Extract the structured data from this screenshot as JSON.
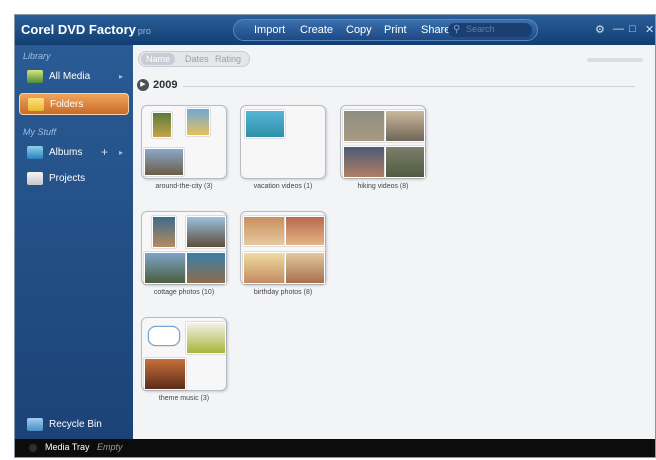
{
  "app": {
    "title": "Corel DVD Factory",
    "title_suffix": "pro"
  },
  "menu": [
    {
      "label": "Import"
    },
    {
      "label": "Create"
    },
    {
      "label": "Copy"
    },
    {
      "label": "Print"
    },
    {
      "label": "Share"
    }
  ],
  "search": {
    "placeholder": "Search"
  },
  "sidebar": {
    "library_heading": "Library",
    "mystuff_heading": "My Stuff",
    "items": [
      {
        "label": "All Media"
      },
      {
        "label": "Folders",
        "selected": true
      },
      {
        "label": "Albums"
      },
      {
        "label": "Projects"
      }
    ],
    "recycle_bin": "Recycle Bin"
  },
  "sort_tabs": [
    {
      "label": "Name",
      "active": true
    },
    {
      "label": "Dates"
    },
    {
      "label": "Rating"
    }
  ],
  "year_group": "2009",
  "folders": [
    {
      "name": "around-the-city (3)"
    },
    {
      "name": "vacation videos (1)"
    },
    {
      "name": "hiking videos (8)"
    },
    {
      "name": "cottage photos (10)"
    },
    {
      "name": "birthday photos (8)"
    },
    {
      "name": "theme music (3)"
    }
  ],
  "media_tray": {
    "label": "Media Tray",
    "value": "Empty"
  },
  "colors": {
    "titlebar": "#1f4f86",
    "sidebar": "#224e85",
    "selected": "#e5893e"
  }
}
